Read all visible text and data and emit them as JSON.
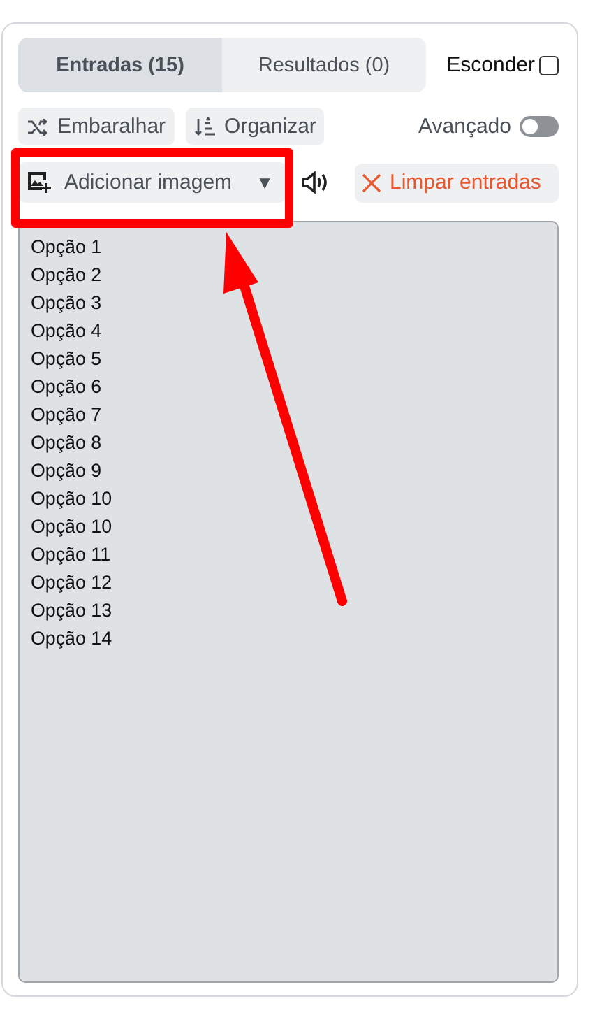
{
  "tabs": [
    {
      "label": "Entradas (15)",
      "selected": true
    },
    {
      "label": "Resultados (0)",
      "selected": false
    }
  ],
  "hide": {
    "label": "Esconder",
    "checked": false
  },
  "tools": [
    {
      "kind": "shuffle",
      "label": "Embaralhar"
    },
    {
      "kind": "sort",
      "label": "Organizar"
    }
  ],
  "advanced": {
    "label": "Avançado",
    "on": false
  },
  "add_image": {
    "label": "Adicionar imagem",
    "caret": "▼"
  },
  "clear": {
    "label": "Limpar entradas"
  },
  "entries": [
    "Opção 1",
    "Opção 2",
    "Opção 3",
    "Opção 4",
    "Opção 5",
    "Opção 6",
    "Opção 7",
    "Opção 8",
    "Opção 9",
    "Opção 10",
    "Opção 10",
    "Opção 11",
    "Opção 12",
    "Opção 13",
    "Opção 14"
  ]
}
